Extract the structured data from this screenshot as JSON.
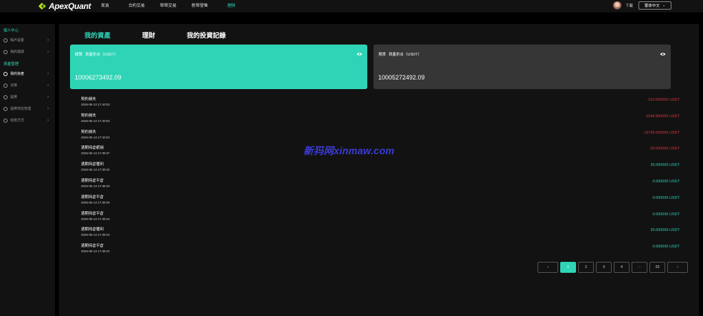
{
  "header": {
    "logo_text": "ApexQuant",
    "nav": [
      {
        "label": "首頁",
        "active": false
      },
      {
        "label": "合約交易",
        "active": false
      },
      {
        "label": "幣幣交易",
        "active": false
      },
      {
        "label": "新幣發售",
        "active": false
      },
      {
        "label": "理財",
        "active": true
      }
    ],
    "download_label": "下載",
    "language": "繁体中文"
  },
  "sidebar": {
    "section1": "個人中心",
    "items1": [
      {
        "label": "賬戶設置"
      },
      {
        "label": "我的邀請"
      }
    ],
    "section2": "資產管理",
    "items2": [
      {
        "label": "我的資產",
        "active": true
      },
      {
        "label": "充幣"
      },
      {
        "label": "提幣"
      },
      {
        "label": "提幣地址管理"
      },
      {
        "label": "收款方式"
      }
    ]
  },
  "main": {
    "tabs": [
      {
        "label": "我的資產",
        "active": true
      },
      {
        "label": "理財",
        "active": false
      },
      {
        "label": "我的投資記錄",
        "active": false
      }
    ],
    "total_card": {
      "label": "總覽",
      "sub": "資產折合（USDT）",
      "value": "10006273492.09"
    },
    "spot_card": {
      "label": "現貨",
      "sub": "資產折合（USDT）",
      "value": "10005272492.09"
    },
    "records": [
      {
        "title": "契約損失",
        "time": "2026-06-13 17:40:03",
        "amount": "-510.000000 USDT",
        "sign": "neg"
      },
      {
        "title": "契約損失",
        "time": "2026-06-13 17:40:03",
        "amount": "-1544.800000 USDT",
        "sign": "neg"
      },
      {
        "title": "契約損失",
        "time": "2026-06-13 17:40:03",
        "amount": "-16799.690000 USDT",
        "sign": "neg"
      },
      {
        "title": "週期持倉虧損",
        "time": "2026-06-13 17:39:37",
        "amount": "-20.000000 USDT",
        "sign": "neg"
      },
      {
        "title": "週期持倉獲利",
        "time": "2026-06-13 17:39:34",
        "amount": "20.000000 USDT",
        "sign": "pos"
      },
      {
        "title": "週期持倉平倉",
        "time": "2026-06-13 17:39:33",
        "amount": "0.000000 USDT",
        "sign": "pos"
      },
      {
        "title": "週期持倉平倉",
        "time": "2026-06-13 17:39:29",
        "amount": "0.000000 USDT",
        "sign": "pos"
      },
      {
        "title": "週期持倉平倉",
        "time": "2026-06-13 17:39:24",
        "amount": "0.000000 USDT",
        "sign": "pos"
      },
      {
        "title": "週期持倉獲利",
        "time": "2026-06-13 17:39:23",
        "amount": "20.000000 USDT",
        "sign": "pos"
      },
      {
        "title": "週期持倉平倉",
        "time": "2026-06-13 17:39:22",
        "amount": "0.000000 USDT",
        "sign": "pos"
      }
    ],
    "pagination": {
      "prev": "‹",
      "pages": [
        "1",
        "2",
        "3",
        "4",
        "···",
        "33"
      ],
      "current": "1",
      "next": "›"
    }
  },
  "watermark": "新犸网xinmaw.com",
  "colors": {
    "accent": "#2fd4b6",
    "negative": "#e2333f",
    "panel": "#121212",
    "card_dark": "#363636"
  }
}
